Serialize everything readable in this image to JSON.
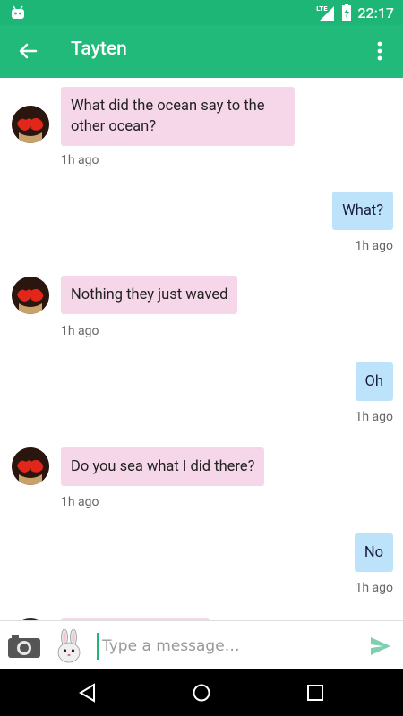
{
  "status": {
    "time": "22:17",
    "network": "LTE"
  },
  "header": {
    "title": "Tayten"
  },
  "messages": [
    {
      "direction": "in",
      "text": "What did the ocean say to the\nother ocean?",
      "time": "1h ago"
    },
    {
      "direction": "out",
      "text": "What?",
      "time": "1h ago"
    },
    {
      "direction": "in",
      "text": "Nothing they just waved",
      "time": "1h ago"
    },
    {
      "direction": "out",
      "text": "Oh",
      "time": "1h ago"
    },
    {
      "direction": "in",
      "text": "Do you sea what I did there?",
      "time": "1h ago"
    },
    {
      "direction": "out",
      "text": "No",
      "time": "1h ago"
    }
  ],
  "composer": {
    "placeholder": "Type a message…"
  },
  "colors": {
    "accent": "#22ba7a",
    "incoming": "#f6d7ea",
    "outgoing": "#bde3fb"
  },
  "icons": [
    "android-icon",
    "lte-signal-icon",
    "battery-icon",
    "back-arrow-icon",
    "more-vert-icon",
    "camera-icon",
    "bunny-sticker-icon",
    "send-icon",
    "nav-back-icon",
    "nav-home-icon",
    "nav-recents-icon"
  ]
}
